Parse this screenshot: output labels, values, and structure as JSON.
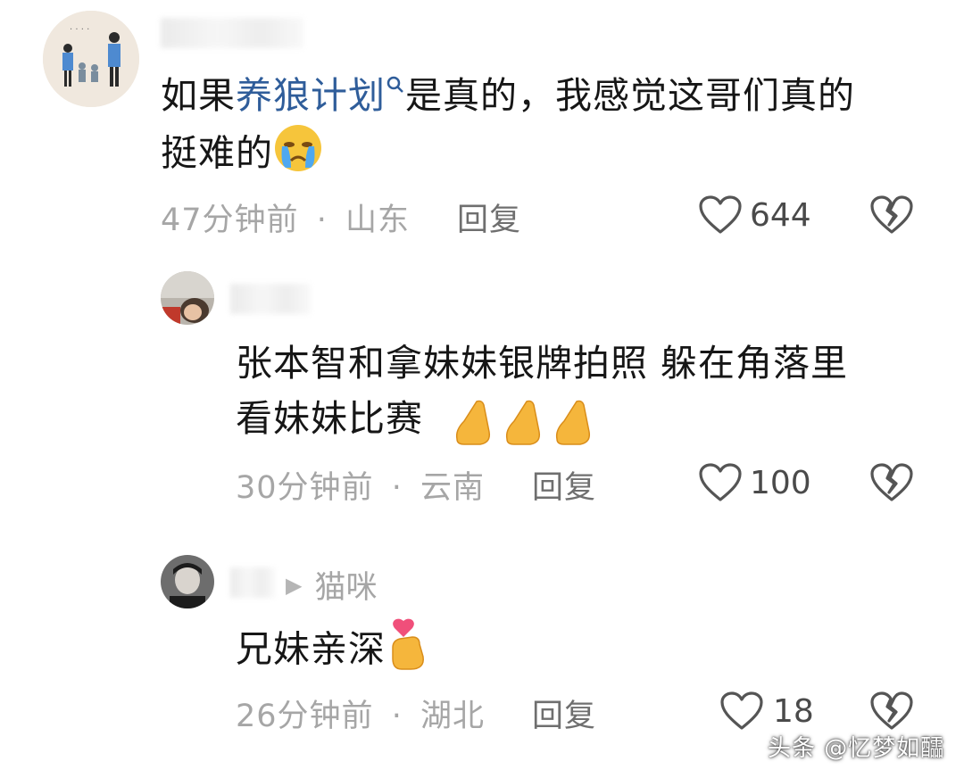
{
  "comments": [
    {
      "text_prefix": "如果",
      "text_link": "养狼计划",
      "text_line1_rest": "是真的，我感觉这哥们真的",
      "text_line2": "挺难的",
      "emoji": "crying-face",
      "time": "47分钟前",
      "separator": "·",
      "location": "山东",
      "reply_label": "回复",
      "likes": "644"
    },
    {
      "text_line1": "张本智和拿妹妹银牌拍照 躲在角落里",
      "text_line2": "看妹妹比赛",
      "emoji": "pinched-fingers",
      "time": "30分钟前",
      "separator": "·",
      "location": "云南",
      "reply_label": "回复",
      "likes": "100"
    },
    {
      "reply_to": "猫咪",
      "text": "兄妹亲深",
      "emoji": "finger-heart",
      "time": "26分钟前",
      "separator": "·",
      "location": "湖北",
      "reply_label": "回复",
      "likes": "18"
    }
  ],
  "watermark": "头条 @忆梦如醽"
}
